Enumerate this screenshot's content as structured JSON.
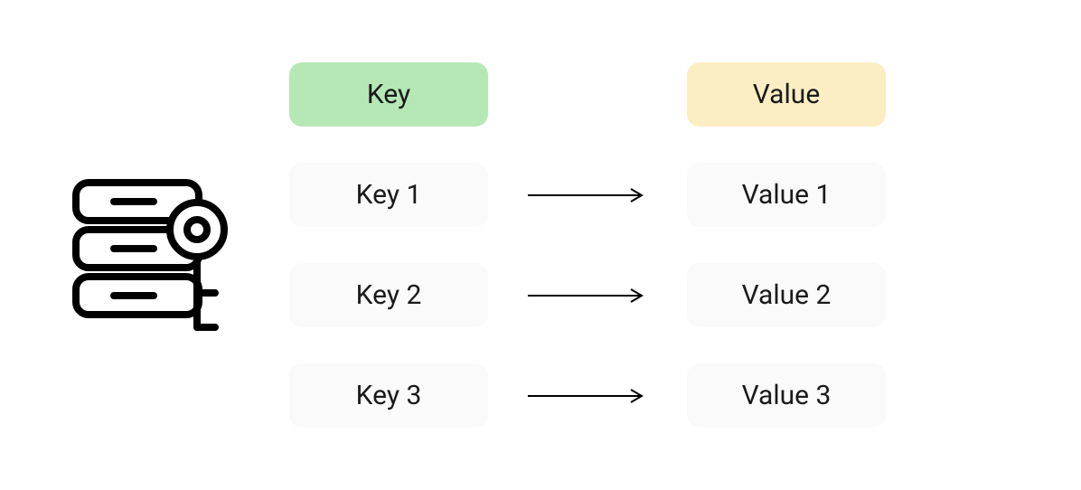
{
  "header": {
    "key": "Key",
    "value": "Value"
  },
  "rows": [
    {
      "key": "Key 1",
      "value": "Value 1"
    },
    {
      "key": "Key 2",
      "value": "Value 2"
    },
    {
      "key": "Key 3",
      "value": "Value 3"
    }
  ],
  "colors": {
    "key_header_bg": "#b5e8b5",
    "value_header_bg": "#fceec3",
    "item_bg": "#fafafa"
  }
}
